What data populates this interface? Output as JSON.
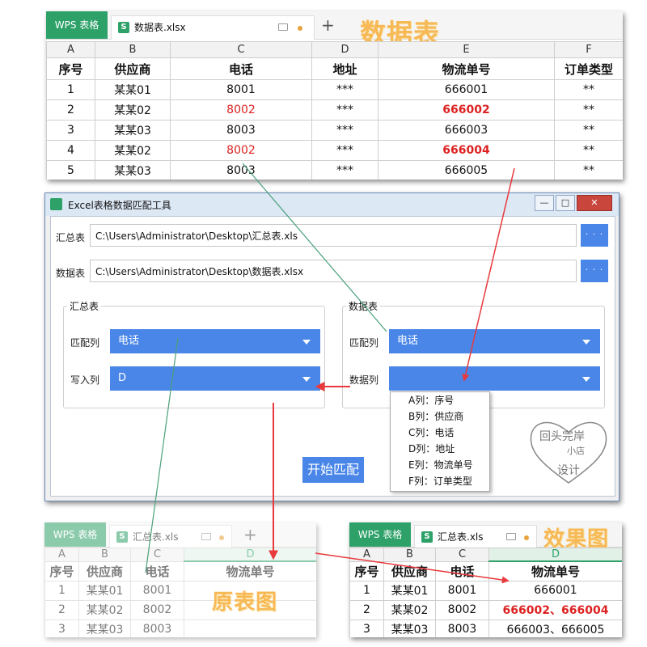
{
  "top_sheet": {
    "wps_label": "WPS 表格",
    "tab_icon": "S",
    "file_name": "数据表.xlsx",
    "new_tab": "+",
    "watermark": "数据表",
    "columns": [
      "A",
      "B",
      "C",
      "D",
      "E",
      "F"
    ],
    "headers": [
      "序号",
      "供应商",
      "电话",
      "地址",
      "物流单号",
      "订单类型"
    ],
    "rows": [
      [
        "1",
        "某某01",
        "8001",
        "***",
        "666001",
        "**"
      ],
      [
        "2",
        "某某02",
        "8002",
        "***",
        "666002",
        "**"
      ],
      [
        "3",
        "某某03",
        "8003",
        "***",
        "666003",
        "**"
      ],
      [
        "4",
        "某某02",
        "8002",
        "***",
        "666004",
        "**"
      ],
      [
        "5",
        "某某03",
        "8003",
        "***",
        "666005",
        "**"
      ]
    ]
  },
  "tool_window": {
    "title": "Excel表格数据匹配工具",
    "controls": {
      "minimize": "—",
      "maximize": "□",
      "close": "✕"
    },
    "summary_label": "汇总表",
    "summary_path": "C:\\Users\\Administrator\\Desktop\\汇总表.xls",
    "data_label": "数据表",
    "data_path": "C:\\Users\\Administrator\\Desktop\\数据表.xlsx",
    "browse": "· · ·",
    "left_group": {
      "title": "汇总表",
      "match_label": "匹配列",
      "match_value": "电话",
      "write_label": "写入列",
      "write_value": "D"
    },
    "right_group": {
      "title": "数据表",
      "match_label": "匹配列",
      "match_value": "电话",
      "data_label": "数据列",
      "data_value": ""
    },
    "dropdown_options": [
      "A列：序号",
      "B列：供应商",
      "C列：电话",
      "D列：地址",
      "E列：物流单号",
      "F列：订单类型"
    ],
    "start_button": "开始匹配",
    "stamp_line1": "回头完岸",
    "stamp_line2": "小店",
    "stamp_line3": "设计"
  },
  "original_sheet": {
    "wps_label": "WPS 表格",
    "tab_icon": "S",
    "file_name": "汇总表.xls",
    "new_tab": "+",
    "watermark": "原表图",
    "columns": [
      "A",
      "B",
      "C",
      "D"
    ],
    "headers": [
      "序号",
      "供应商",
      "电话",
      "物流单号"
    ],
    "rows": [
      [
        "1",
        "某某01",
        "8001",
        ""
      ],
      [
        "2",
        "某某02",
        "8002",
        ""
      ],
      [
        "3",
        "某某03",
        "8003",
        ""
      ]
    ]
  },
  "result_sheet": {
    "wps_label": "WPS 表格",
    "tab_icon": "S",
    "file_name": "汇总表.xls",
    "watermark": "效果图",
    "columns": [
      "A",
      "B",
      "C",
      "D"
    ],
    "headers": [
      "序号",
      "供应商",
      "电话",
      "物流单号"
    ],
    "rows": [
      [
        "1",
        "某某01",
        "8001",
        "666001"
      ],
      [
        "2",
        "某某02",
        "8002",
        "666002、666004"
      ],
      [
        "3",
        "某某03",
        "8003",
        "666003、666005"
      ]
    ]
  },
  "colors": {
    "wps_green": "#2ea169",
    "button_blue": "#4a86e8",
    "highlight_red": "#dd2222",
    "arrow_red": "#e8393c",
    "line_green": "#4aa07a",
    "watermark_orange": "#f7b955"
  }
}
